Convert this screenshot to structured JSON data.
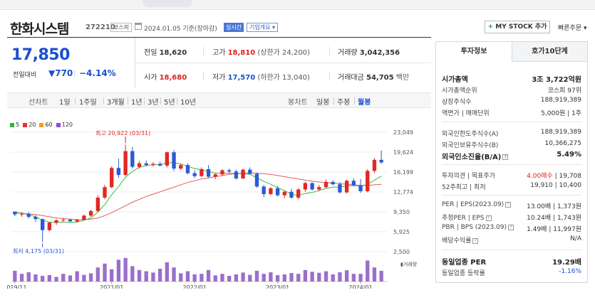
{
  "header": {
    "company": "한화시스템",
    "code": "272210",
    "market": "코스피",
    "date_text": "2024.01.05 기준(장마감)",
    "live_badge": "실시간",
    "overview_badge": "기업개요 ▾",
    "mystock_plus": "+",
    "mystock_label": " MY STOCK 추가",
    "quick_order": "빠른주문 ▾"
  },
  "price": {
    "current": "17,850",
    "change_label": "전일대비",
    "change_value": "▼770",
    "change_sep": "|",
    "change_pct": "−4.14%"
  },
  "stats": {
    "prev_label": "전일",
    "prev_value": "18,620",
    "high_label": "고가",
    "high_value": "18,810",
    "high_limit": "(상한가 24,200)",
    "volume_label": "거래량",
    "volume_value": "3,042,356",
    "open_label": "시가",
    "open_value": "18,680",
    "low_label": "저가",
    "low_value": "17,570",
    "low_limit": "(하한가 13,040)",
    "amount_label": "거래대금",
    "amount_value": "54,705",
    "amount_unit": "백만"
  },
  "chart_tabs": {
    "line_label": "선차트",
    "line_tabs": [
      "1일",
      "1주일",
      "3개월",
      "1년",
      "3년",
      "5년",
      "10년"
    ],
    "candle_label": "봉차트",
    "candle_tabs": [
      "일봉",
      "주봉",
      "월봉"
    ],
    "active_candle": "월봉"
  },
  "legend": [
    {
      "label": "5",
      "color": "#2eb82e"
    },
    {
      "label": "20",
      "color": "#e83030"
    },
    {
      "label": "60",
      "color": "#f0a020"
    },
    {
      "label": "120",
      "color": "#8a4fd6"
    }
  ],
  "chart_data": {
    "type": "candlestick",
    "y_ticks": [
      "23,049",
      "19,624",
      "16,199",
      "12,774",
      "9,350",
      "5,925",
      "2,500"
    ],
    "x_ticks": [
      "2019/11",
      "2021/01",
      "2022/01",
      "2023/01",
      "2024/01"
    ],
    "high_note": "최고 20,922 (03/31)",
    "low_note": "최저 4,175 (03/31)",
    "volume_label": "거래량",
    "ylim": [
      2500,
      23049
    ],
    "candles": [
      [
        9400,
        9400,
        8600,
        8900
      ],
      [
        8900,
        9300,
        8500,
        9000
      ],
      [
        9000,
        9300,
        8200,
        8500
      ],
      [
        8500,
        8800,
        7600,
        8100
      ],
      [
        8100,
        8200,
        4175,
        6200
      ],
      [
        6200,
        7600,
        6000,
        7500
      ],
      [
        7500,
        8100,
        7100,
        7900
      ],
      [
        7900,
        8300,
        7600,
        8000
      ],
      [
        8000,
        8200,
        7600,
        7700
      ],
      [
        7700,
        8100,
        7500,
        8000
      ],
      [
        8000,
        8900,
        7900,
        8700
      ],
      [
        8700,
        9700,
        8500,
        9500
      ],
      [
        9500,
        12200,
        9300,
        11800
      ],
      [
        11800,
        14000,
        11500,
        13600
      ],
      [
        13600,
        17200,
        13400,
        16900
      ],
      [
        16900,
        18500,
        15200,
        15700
      ],
      [
        15700,
        20922,
        15500,
        19800
      ],
      [
        19800,
        20500,
        16800,
        17100
      ],
      [
        17100,
        18100,
        16800,
        17700
      ],
      [
        17700,
        18200,
        17200,
        17400
      ],
      [
        17400,
        17900,
        17100,
        17600
      ],
      [
        17600,
        18000,
        17200,
        17300
      ],
      [
        17300,
        19700,
        17000,
        19600
      ],
      [
        19600,
        20000,
        16400,
        16800
      ],
      [
        16800,
        17600,
        16500,
        17400
      ],
      [
        17400,
        17700,
        15800,
        16000
      ],
      [
        16000,
        16500,
        15200,
        15500
      ],
      [
        15500,
        17000,
        15300,
        16700
      ],
      [
        16700,
        17400,
        15200,
        15400
      ],
      [
        15400,
        16000,
        15000,
        15800
      ],
      [
        15800,
        16700,
        15500,
        16500
      ],
      [
        16500,
        16800,
        16000,
        16300
      ],
      [
        16300,
        16600,
        14900,
        15100
      ],
      [
        15100,
        16800,
        15000,
        16600
      ],
      [
        16600,
        17000,
        15700,
        15900
      ],
      [
        15900,
        16100,
        13500,
        13700
      ],
      [
        13700,
        14000,
        11900,
        12400
      ],
      [
        12400,
        13600,
        12200,
        13400
      ],
      [
        13400,
        13800,
        12000,
        12200
      ],
      [
        12200,
        13000,
        11700,
        12800
      ],
      [
        12800,
        13300,
        11600,
        11800
      ],
      [
        11800,
        13400,
        11500,
        13200
      ],
      [
        13200,
        14500,
        12800,
        14300
      ],
      [
        14300,
        14400,
        13000,
        13200
      ],
      [
        13200,
        14000,
        12900,
        13600
      ],
      [
        13600,
        14900,
        13400,
        14500
      ],
      [
        14500,
        14800,
        13900,
        14100
      ],
      [
        14100,
        14500,
        12500,
        12700
      ],
      [
        12700,
        14900,
        12500,
        14700
      ],
      [
        14700,
        15100,
        13700,
        13900
      ],
      [
        13900,
        15000,
        12600,
        12900
      ],
      [
        12900,
        16700,
        12700,
        16400
      ],
      [
        16400,
        18600,
        16000,
        18300
      ],
      [
        18300,
        19900,
        17600,
        17850
      ]
    ],
    "ma20": [
      9200,
      9100,
      9000,
      8900,
      8700,
      8500,
      8300,
      8200,
      8100,
      8000,
      8000,
      8100,
      8300,
      8700,
      9200,
      9800,
      10400,
      11000,
      11500,
      12000,
      12400,
      12800,
      13200,
      13600,
      14000,
      14400,
      14700,
      15000,
      15200,
      15400,
      15600,
      15800,
      15900,
      16000,
      16000,
      16000,
      15900,
      15800,
      15600,
      15400,
      15200,
      15000,
      14800,
      14600,
      14500,
      14400,
      14300,
      14200,
      14100,
      14000,
      13900,
      13900,
      14000,
      14100
    ],
    "ma5": [
      9300,
      9100,
      8900,
      8500,
      7900,
      7600,
      7500,
      7600,
      7500,
      7600,
      7900,
      8300,
      9300,
      10600,
      12300,
      13700,
      15300,
      16300,
      17000,
      17300,
      17500,
      17500,
      17800,
      17800,
      17600,
      17200,
      16800,
      16600,
      16300,
      16000,
      16000,
      16000,
      15900,
      15900,
      15800,
      15200,
      14600,
      14100,
      13500,
      13000,
      12400,
      12200,
      12500,
      12700,
      13000,
      13400,
      13600,
      13600,
      13800,
      13900,
      13700,
      14100,
      14800,
      15500
    ],
    "volumes": [
      0.42,
      0.3,
      0.36,
      0.28,
      0.22,
      0.25,
      0.18,
      0.3,
      0.24,
      0.4,
      0.26,
      0.32,
      0.55,
      0.7,
      0.48,
      0.85,
      0.92,
      0.6,
      0.45,
      0.4,
      0.35,
      0.5,
      0.75,
      0.55,
      0.32,
      0.4,
      0.28,
      0.3,
      0.45,
      0.24,
      0.3,
      0.22,
      0.28,
      0.35,
      0.26,
      0.42,
      0.3,
      0.36,
      0.25,
      0.28,
      0.33,
      0.3,
      0.45,
      0.38,
      0.34,
      0.4,
      0.28,
      0.36,
      0.44,
      0.3,
      0.3,
      0.82,
      0.55,
      0.42
    ]
  },
  "sidebar": {
    "tab_invest": "투자정보",
    "tab_orderbook": "호가10단계",
    "market_cap_label": "시가총액",
    "market_cap_value": "3조 3,722억원",
    "rank_label": "시가총액순위",
    "rank_value": "코스피 97위",
    "shares_label": "상장주식수",
    "shares_value": "188,919,389",
    "par_label": "액면가 | 매매단위",
    "par_value": "5,000원 | 1주",
    "foreign_limit_label": "외국인한도주식수(A)",
    "foreign_limit_value": "188,919,389",
    "foreign_own_label": "외국인보유주식수(B)",
    "foreign_own_value": "10,366,275",
    "foreign_ratio_label": "외국인소진율(B/A)",
    "foreign_ratio_value": "5.49%",
    "opinion_label": "투자의견 | 목표주가",
    "opinion_value": "4.00매수",
    "target_value": "| 19,708",
    "w52_label": "52주최고 | 최저",
    "w52_value": "19,910 | 10,400",
    "per_label": "PER | EPS(2023.09)",
    "per_value": "13.00배 | 1,373원",
    "est_per_label": "추정PER | EPS",
    "est_per_value": "10.24배 | 1,743원",
    "pbr_label": "PBR | BPS (2023.09)",
    "pbr_value": "1.49배 | 11,997원",
    "div_label": "배당수익률",
    "div_value": "N/A",
    "industry_per_label": "동일업종 PER",
    "industry_per_value": "19.29배",
    "industry_rate_label": "동일업종 등락률",
    "industry_rate_value": "-1.16%",
    "help_glyph": "?"
  }
}
